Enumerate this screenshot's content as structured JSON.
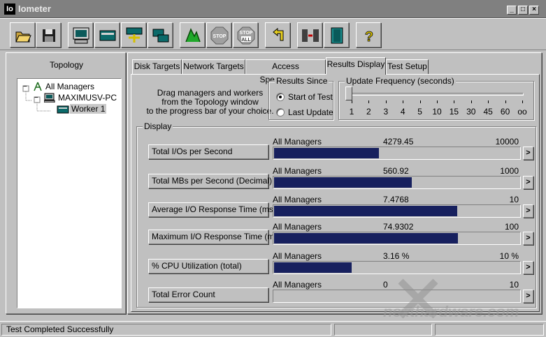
{
  "window": {
    "icon_text": "Io",
    "title": "Iometer",
    "buttons": [
      "_",
      "□",
      "×"
    ]
  },
  "toolbar": {
    "buttons": [
      {
        "name": "open-icon"
      },
      {
        "name": "save-icon"
      },
      {
        "name": "new-manager-icon"
      },
      {
        "name": "new-disk-worker-icon"
      },
      {
        "name": "new-network-worker-icon"
      },
      {
        "name": "duplicate-worker-icon"
      },
      {
        "name": "start-tests-icon"
      },
      {
        "name": "stop-icon"
      },
      {
        "name": "stop-all-icon"
      },
      {
        "name": "reset-workers-icon"
      },
      {
        "name": "disconnect-managers-icon"
      },
      {
        "name": "exit-icon"
      },
      {
        "name": "help-icon"
      }
    ],
    "stop_text": "STOP",
    "stop_all_text": "ALL",
    "help_text": "?"
  },
  "topology": {
    "title": "Topology",
    "tree": [
      {
        "label": "All Managers",
        "level": 0,
        "expander": "−"
      },
      {
        "label": "MAXIMUSV-PC",
        "level": 1,
        "expander": "−"
      },
      {
        "label": "Worker 1",
        "level": 2,
        "selected": true
      }
    ]
  },
  "tabs": [
    {
      "label": "Disk Targets",
      "active": false
    },
    {
      "label": "Network Targets",
      "active": false
    },
    {
      "label": "Access Specifications",
      "active": false
    },
    {
      "label": "Results Display",
      "active": true
    },
    {
      "label": "Test Setup",
      "active": false
    }
  ],
  "results": {
    "instructions": [
      "Drag managers and workers",
      "from the Topology window",
      "to the progress bar of your choice."
    ],
    "results_since": {
      "title": "Results Since",
      "options": [
        {
          "label": "Start of Test",
          "checked": true
        },
        {
          "label": "Last Update",
          "checked": false
        }
      ]
    },
    "update_frequency": {
      "title": "Update Frequency (seconds)",
      "ticks": [
        "1",
        "2",
        "3",
        "4",
        "5",
        "10",
        "15",
        "30",
        "45",
        "60",
        "oo"
      ],
      "selected_index": 0
    },
    "display": {
      "title": "Display",
      "metrics": [
        {
          "button": "Total I/Os per Second",
          "source": "All Managers",
          "value": "4279.45",
          "max": "10000",
          "fraction": 0.42795,
          "more": ">"
        },
        {
          "button": "Total MBs per Second (Decimal)",
          "source": "All Managers",
          "value": "560.92",
          "max": "1000",
          "fraction": 0.5609,
          "more": ">"
        },
        {
          "button": "Average I/O Response Time (ms)",
          "source": "All Managers",
          "value": "7.4768",
          "max": "10",
          "fraction": 0.7477,
          "more": ">"
        },
        {
          "button": "Maximum I/O Response Time (ms)",
          "source": "All Managers",
          "value": "74.9302",
          "max": "100",
          "fraction": 0.7493,
          "more": ">"
        },
        {
          "button": "% CPU Utilization (total)",
          "source": "All Managers",
          "value": "3.16 %",
          "max": "10 %",
          "fraction": 0.316,
          "more": ">"
        },
        {
          "button": "Total Error Count",
          "source": "All Managers",
          "value": "0",
          "max": "10",
          "fraction": 0,
          "more": ">"
        }
      ]
    }
  },
  "status_bar": {
    "message": "Test Completed Successfully"
  },
  "watermark": {
    "text": "nexthardware.com"
  },
  "colors": {
    "bar_fill": "#17205e",
    "face": "#c0c0c0",
    "titlebar": "#808080"
  }
}
